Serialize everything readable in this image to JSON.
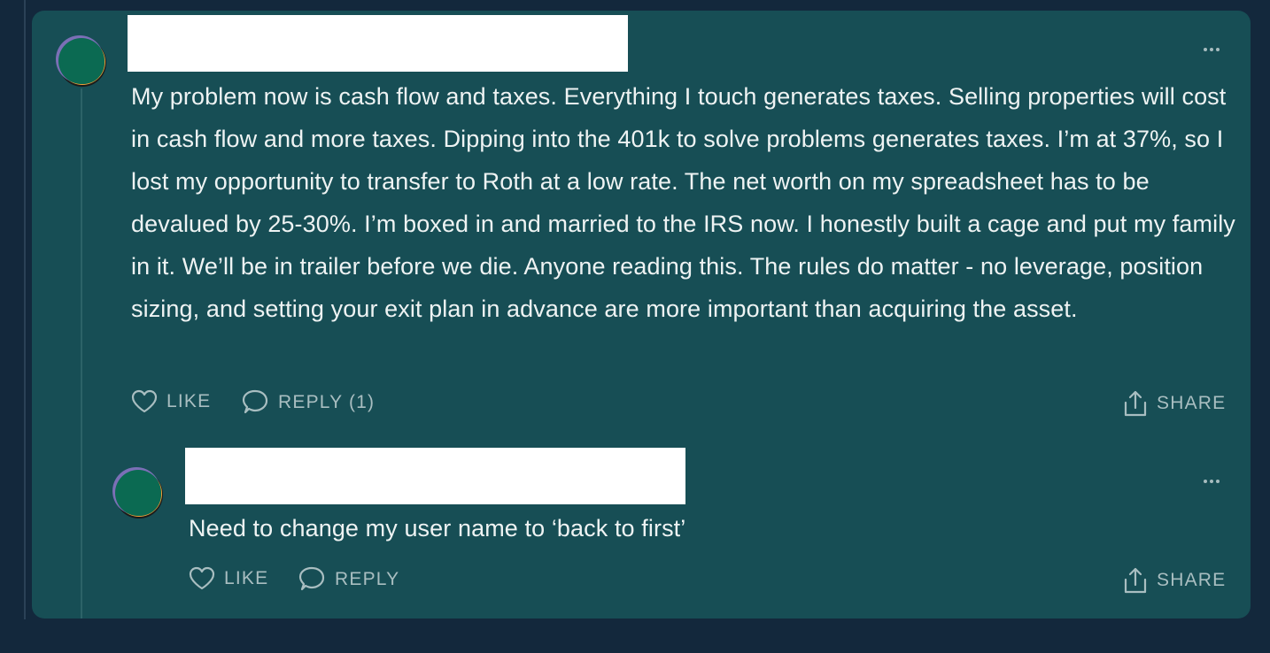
{
  "comment": {
    "author": "",
    "text": "My problem now is cash flow and taxes. Everything I touch generates taxes. Selling properties will cost in cash flow and more taxes. Dipping into the 401k to solve problems generates taxes. I’m at 37%, so I lost my opportunity to transfer to Roth at a low rate. The net worth on my spreadsheet has to be devalued by 25-30%. I’m boxed in and married to the IRS now. I honestly built a cage and put my family in it. We’ll be in trailer before we die. Anyone reading this. The rules do matter - no leverage, position sizing, and setting your exit plan in advance are more important than acquiring the asset.",
    "actions": {
      "like_label": "LIKE",
      "reply_label": "REPLY (1)",
      "share_label": "SHARE"
    }
  },
  "reply": {
    "author": "",
    "text": "Need to change my user name to ‘back to first’",
    "actions": {
      "like_label": "LIKE",
      "reply_label": "REPLY",
      "share_label": "SHARE"
    }
  },
  "icons": {
    "like": "heart-icon",
    "reply": "speech-bubble-icon",
    "share": "share-icon",
    "more": "more-options-icon"
  },
  "colors": {
    "page_background": "#13283c",
    "card_background": "#174e55",
    "text": "#eef3f3",
    "muted": "#a9bec1",
    "avatar_green": "#0b6a52",
    "avatar_orange": "#f2a23a"
  }
}
